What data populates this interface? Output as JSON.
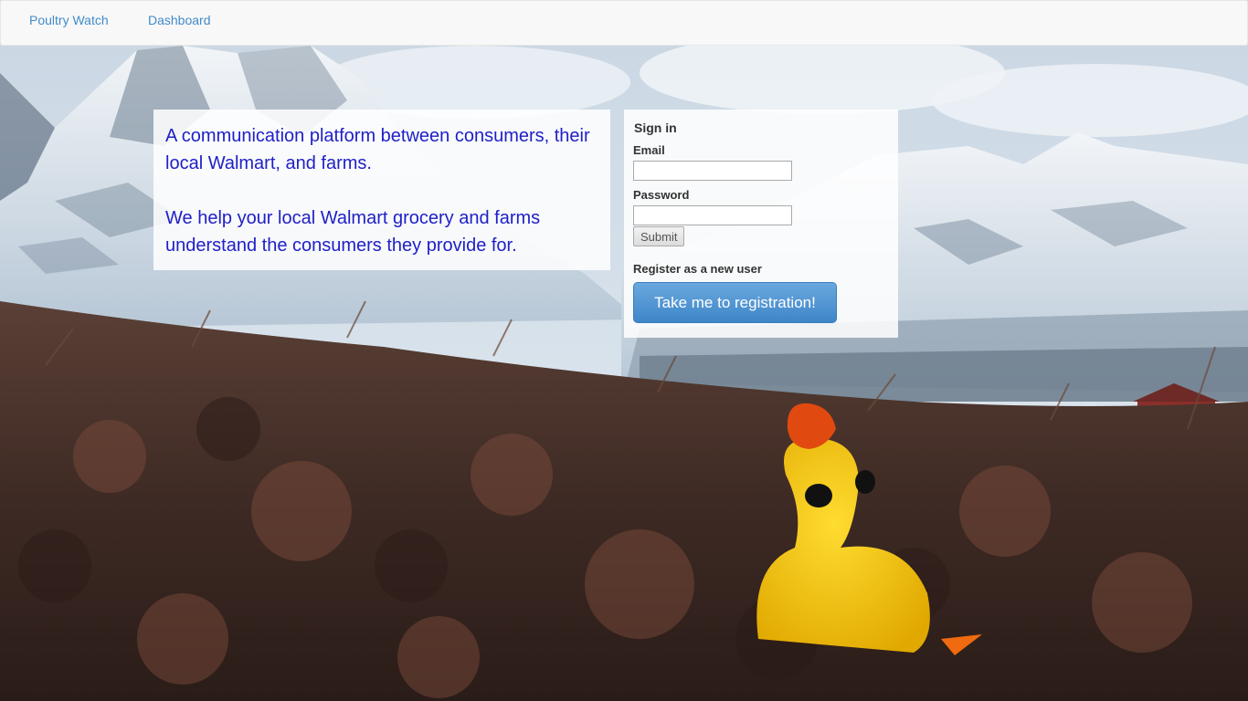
{
  "navbar": {
    "brand": "Poultry Watch",
    "links": [
      {
        "label": "Dashboard"
      }
    ]
  },
  "intro": {
    "paragraph_1": "A communication platform between consumers, their local Walmart, and farms.",
    "paragraph_2": "We help your local Walmart grocery and farms understand the consumers they provide for.",
    "text_color": "#2020c8"
  },
  "signin": {
    "title": "Sign in",
    "email_label": "Email",
    "email_value": "",
    "password_label": "Password",
    "password_value": "",
    "submit_label": "Submit"
  },
  "register": {
    "label": "Register as a new user",
    "button_label": "Take me to registration!",
    "button_color": "#4a90d2"
  },
  "background": {
    "description_icon": "mountain-landscape-with-toy-chicken",
    "accent_colors": {
      "sky": "#dfe8f0",
      "snow": "#e8eef4",
      "heather": "#4a3028",
      "chicken": "#f5c20f",
      "comb": "#e04a10"
    }
  }
}
